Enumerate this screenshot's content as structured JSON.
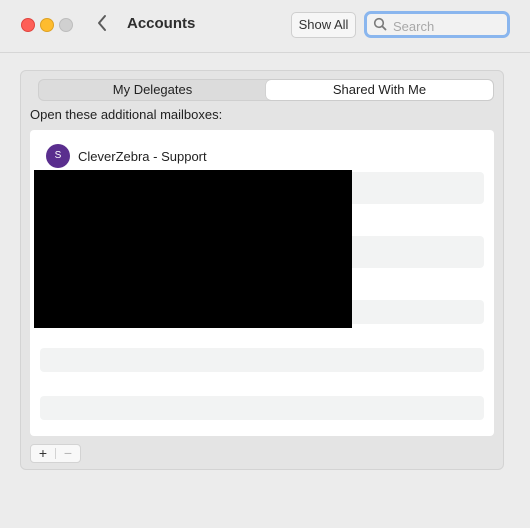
{
  "window": {
    "title": "Accounts",
    "back_glyph": "‹",
    "show_all_label": "Show All",
    "search": {
      "placeholder": "Search",
      "value": ""
    }
  },
  "tabs": [
    {
      "label": "My Delegates",
      "selected": false
    },
    {
      "label": "Shared With Me",
      "selected": true
    }
  ],
  "instruction": "Open these additional mailboxes:",
  "mailboxes": [
    {
      "avatar_initial": "S",
      "name": "CleverZebra - Support",
      "avatar_color": "#5a2e8e"
    }
  ],
  "controls": {
    "add_label": "+",
    "remove_label": "−"
  },
  "colors": {
    "accent_focus": "#8ab6ee",
    "avatar": "#5a2e8e",
    "redaction": "#000000"
  }
}
